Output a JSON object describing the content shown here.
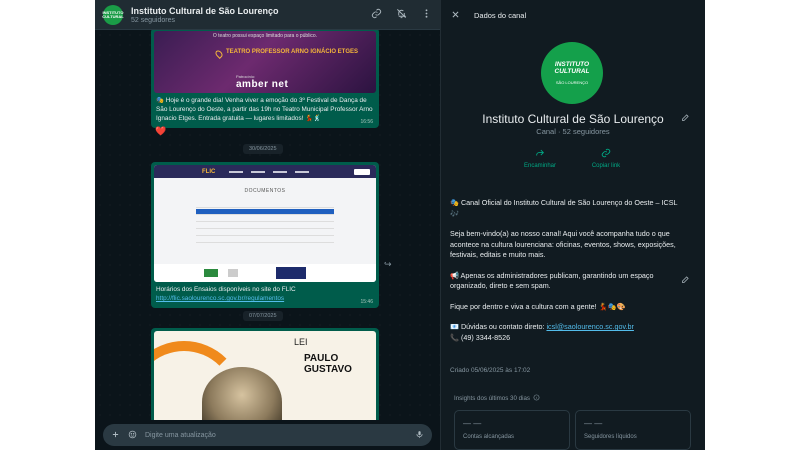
{
  "channel": {
    "name": "Instituto Cultural de São Lourenço",
    "followers": "52 seguidores",
    "avatar_text": "INSTITUTO CULTURAL",
    "avatar_sub": "SÃO LOURENÇO"
  },
  "messages": [
    {
      "image_note": "O teatro possui espaço limitado para o público.",
      "image_title": "TEATRO PROFESSOR ARNO IGNÁCIO ETGES",
      "image_sponsor_label": "Patrocínio:",
      "image_sponsor": "amber net",
      "caption": "🎭 Hoje é o grande dia! Venha viver a emoção do 3º Festival de Dança de São Lourenço do Oeste, a partir das 19h no Teatro Municipal Professor Arno Ignacio Etges. Entrada gratuita — lugares limitados! 💃🕺",
      "time": "16:56",
      "reaction": "❤️"
    },
    {
      "date": "30/06/2025",
      "image_heading": "DOCUMENTOS",
      "image_logo": "FLIC",
      "caption": "Horários dos Ensaios disponíveis no site do FLIC",
      "link": "http://flic.saolourenco.sc.gov.br/regulamentos",
      "time": "15:46"
    },
    {
      "date": "07/07/2025",
      "image_lei": "LEI",
      "image_title": "PAULO GUSTAVO"
    }
  ],
  "composer": {
    "placeholder": "Digite uma atualização"
  },
  "info": {
    "header_title": "Dados do canal",
    "subtitle": "Canal · 52 seguidores",
    "actions": [
      {
        "label": "Encaminhar"
      },
      {
        "label": "Copiar link"
      }
    ],
    "description": [
      "🎭 Canal Oficial do Instituto Cultural de São Lourenço do Oeste – ICSL 🎶",
      "Seja bem-vindo(a) ao nosso canal! Aqui você acompanha tudo o que acontece na cultura lourenciana: oficinas, eventos, shows, exposições, festivais, editais e muito mais.",
      "📢 Apenas os administradores publicam, garantindo um espaço organizado, direto e sem spam.",
      "Fique por dentro e viva a cultura com a gente! 💃🎭🎨"
    ],
    "contact_prefix": "📧 Dúvidas ou contato direto: ",
    "contact_email": "icsl@saolourenco.sc.gov.br",
    "contact_phone": "📞 (49) 3344-8526",
    "created": "Criado 05/06/2025 às 17:02",
    "insights_title": "Insights dos últimos 30 dias",
    "cards": [
      {
        "value": "— —",
        "label": "Contas alcançadas"
      },
      {
        "value": "— —",
        "label": "Seguidores líquidos"
      }
    ]
  }
}
